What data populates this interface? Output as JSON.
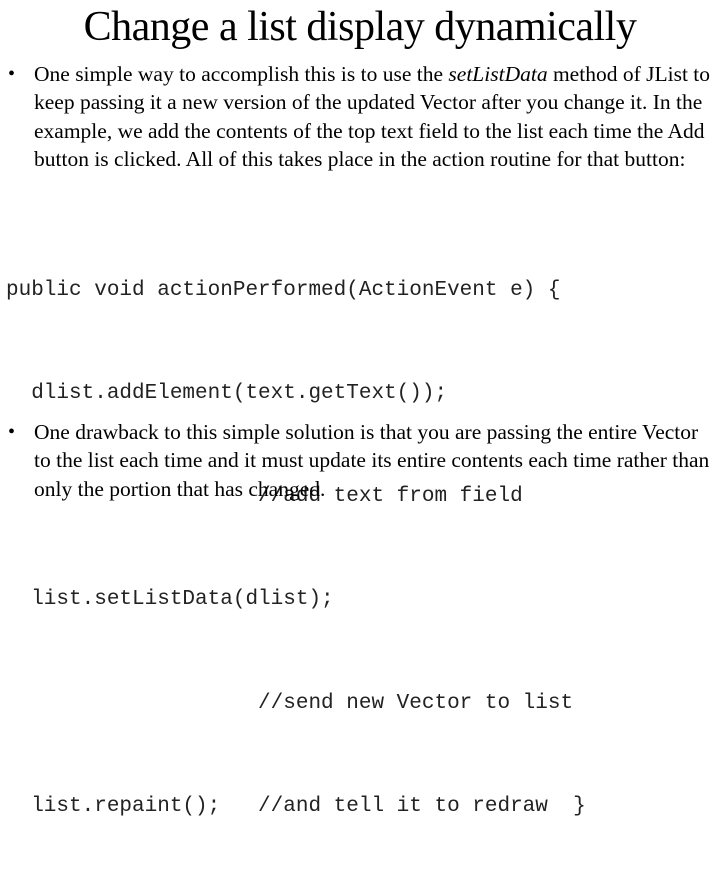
{
  "slide": {
    "title": "Change a list display dynamically",
    "bullets": [
      {
        "glyph": "•",
        "text_before": "One simple way to accomplish this is to use the ",
        "emphasis": "setListData",
        "text_after": " method of JList to keep passing it a new version of the updated Vector after you change it. In the example, we add the contents of the top text field to the list each time the Add button is clicked. All of this takes place in the action routine for that button:"
      },
      {
        "glyph": "•",
        "text": "One drawback to this simple solution is that you are passing the entire Vector to the list each time and it must update its entire contents each time rather than only the portion that has changed."
      }
    ],
    "code_lines": [
      "public void actionPerformed(ActionEvent e) {",
      "  dlist.addElement(text.getText());",
      "                    //add text from field",
      "  list.setListData(dlist);",
      "                    //send new Vector to list",
      "  list.repaint();   //and tell it to redraw  }"
    ]
  }
}
